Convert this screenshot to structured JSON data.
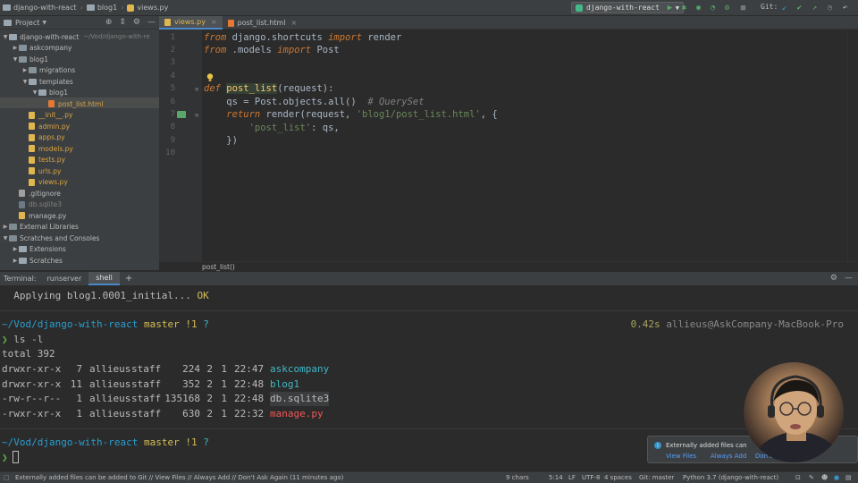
{
  "breadcrumb": {
    "project": "django-with-react",
    "folder": "blog1",
    "file": "views.py"
  },
  "toolbar": {
    "run_config": "django-with-react",
    "git_label": "Git:"
  },
  "project_panel": {
    "title": "Project",
    "tree": [
      {
        "label": "django-with-react",
        "hint": "~/Vod/django-with-re",
        "kind": "folder",
        "depth": 0,
        "open": true
      },
      {
        "label": "askcompany",
        "kind": "pkg",
        "depth": 1,
        "open": false
      },
      {
        "label": "blog1",
        "kind": "pkg",
        "depth": 1,
        "open": true
      },
      {
        "label": "migrations",
        "kind": "pkg",
        "depth": 2,
        "open": false
      },
      {
        "label": "templates",
        "kind": "folder",
        "depth": 2,
        "open": true
      },
      {
        "label": "blog1",
        "kind": "folder",
        "depth": 3,
        "open": true
      },
      {
        "label": "post_list.html",
        "kind": "html",
        "depth": 4,
        "color": "orange"
      },
      {
        "label": "__init__.py",
        "kind": "py",
        "depth": 2,
        "color": "orange"
      },
      {
        "label": "admin.py",
        "kind": "py",
        "depth": 2,
        "color": "orange"
      },
      {
        "label": "apps.py",
        "kind": "py",
        "depth": 2,
        "color": "orange"
      },
      {
        "label": "models.py",
        "kind": "py",
        "depth": 2,
        "color": "orange"
      },
      {
        "label": "tests.py",
        "kind": "py",
        "depth": 2,
        "color": "orange"
      },
      {
        "label": "urls.py",
        "kind": "py",
        "depth": 2,
        "color": "orange"
      },
      {
        "label": "views.py",
        "kind": "py",
        "depth": 2,
        "color": "orange"
      },
      {
        "label": ".gitignore",
        "kind": "misc",
        "depth": 1
      },
      {
        "label": "db.sqlite3",
        "kind": "db",
        "depth": 1,
        "color": "gray"
      },
      {
        "label": "manage.py",
        "kind": "py",
        "depth": 1
      },
      {
        "label": "External Libraries",
        "kind": "lib",
        "depth": 0,
        "open": false
      },
      {
        "label": "Scratches and Consoles",
        "kind": "lib",
        "depth": 0,
        "open": true
      },
      {
        "label": "Extensions",
        "kind": "folder",
        "depth": 1,
        "open": false
      },
      {
        "label": "Scratches",
        "kind": "folder",
        "depth": 1,
        "open": false
      }
    ]
  },
  "editor": {
    "tabs": [
      {
        "label": "views.py",
        "active": true,
        "icon": "python-file-icon"
      },
      {
        "label": "post_list.html",
        "active": false,
        "icon": "html-file-icon"
      }
    ],
    "line_numbers": [
      "1",
      "2",
      "3",
      "4",
      "5",
      "6",
      "7",
      "8",
      "9",
      "10"
    ],
    "breadcrumb": "post_list()"
  },
  "terminal": {
    "label": "Terminal:",
    "tabs": [
      {
        "label": "runserver",
        "active": false
      },
      {
        "label": "shell",
        "active": true
      }
    ],
    "migration_text": "  Applying blog1.0001_initial... ",
    "migration_ok": "OK",
    "prompt1": {
      "path": "~/Vod/django-with-react",
      "branch": "master",
      "changes": "!1",
      "status": "?"
    },
    "timing": "0.42s",
    "user_host": "allieus@AskCompany-MacBook-Pro",
    "prompt_char": "❯",
    "command": "ls -l",
    "total": "total 392",
    "listing": [
      {
        "perms": "drwxr-xr-x",
        "links": "7",
        "user": "allieus",
        "group": "staff",
        "size": "224",
        "m": "2",
        "d": "1",
        "time": "22:47",
        "name": "askcompany",
        "color": "cyan"
      },
      {
        "perms": "drwxr-xr-x",
        "links": "11",
        "user": "allieus",
        "group": "staff",
        "size": "352",
        "m": "2",
        "d": "1",
        "time": "22:48",
        "name": "blog1",
        "color": "cyan"
      },
      {
        "perms": "-rw-r--r--",
        "links": "1",
        "user": "allieus",
        "group": "staff",
        "size": "135168",
        "m": "2",
        "d": "1",
        "time": "22:48",
        "name": "db.sqlite3",
        "color": "plain"
      },
      {
        "perms": "-rwxr-xr-x",
        "links": "1",
        "user": "allieus",
        "group": "staff",
        "size": "630",
        "m": "2",
        "d": "1",
        "time": "22:32",
        "name": "manage.py",
        "color": "red"
      }
    ],
    "prompt2": {
      "path": "~/Vod/django-with-react",
      "branch": "master",
      "changes": "!1",
      "status": "?"
    }
  },
  "notification": {
    "title": "Externally added files can",
    "actions": [
      "View Files",
      "Always Add",
      "Don't"
    ]
  },
  "statusbar": {
    "message": "Externally added files can be added to Git // View Files // Always Add // Don't Ask Again (11 minutes ago)",
    "chars": "9 chars",
    "position": "5:14",
    "line_sep": "LF",
    "encoding": "UTF-8",
    "indent": "4 spaces",
    "git_branch": "Git: master",
    "interpreter": "Python 3.7 (django-with-react)"
  },
  "colors": {
    "background": "#2b2b2b",
    "panel": "#3c3f41",
    "accent": "#4a88c7",
    "keyword": "#cc7832",
    "string": "#6a8759"
  }
}
